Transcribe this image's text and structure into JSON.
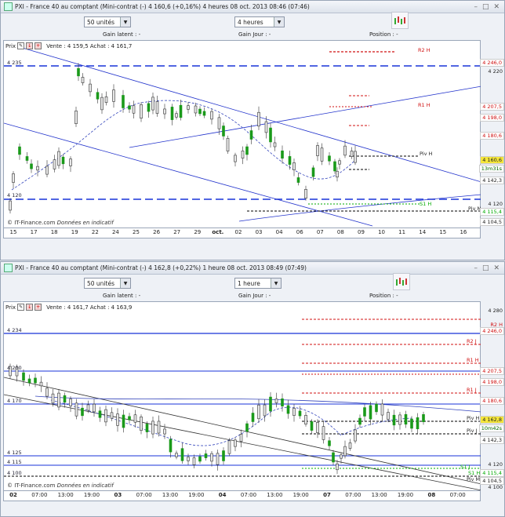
{
  "w1": {
    "title": "PXI - France 40 au comptant (Mini-contrat  (-)  4 160,6 (+0,16%)  4 heures  08 oct. 2013 08:46 (07:46)",
    "units": "50 unités",
    "period": "4 heures",
    "gain_latent": "Gain latent : -",
    "gain_jour": "Gain Jour : -",
    "position": "Position : -",
    "prix": "Prix",
    "quote": "Vente : 4 159,5 Achat : 4 161,7",
    "credit_a": "© IT-Finance.com",
    "credit_b": "Données en indicatif",
    "left_levels": [
      "4 235",
      "4 120"
    ],
    "axis_prices": [
      "4 246,0",
      "4 220",
      "4 207,5",
      "4 198,0",
      "4 180,6",
      "4 160,6",
      "13m31s",
      "4 142,3",
      "4 120",
      "4 115,4",
      "4 104,5"
    ],
    "pivots": [
      "R2 H",
      "R1 H",
      "Piv H",
      "S1 H",
      "Piv M"
    ],
    "xlabels": [
      "15",
      "17",
      "18",
      "19",
      "22",
      "24",
      "25",
      "26",
      "27",
      "29",
      "oct.",
      "02",
      "03",
      "04",
      "06",
      "07",
      "08",
      "09",
      "10",
      "11",
      "14",
      "15",
      "16"
    ]
  },
  "w2": {
    "title": "PXI - France 40 au comptant (Mini-contrat  (-)  4 162,8 (+0,22%)  1 heure  08 oct. 2013 08:49 (07:49)",
    "units": "50 unités",
    "period": "1 heure",
    "gain_latent": "Gain latent : -",
    "gain_jour": "Gain Jour : -",
    "position": "Position : -",
    "prix": "Prix",
    "quote": "Vente : 4 161,7 Achat : 4 163,9",
    "credit_a": "© IT-Finance.com",
    "credit_b": "Données en indicatif",
    "left_levels": [
      "4 234",
      "4 200",
      "4 170",
      "4 125",
      "4 115",
      "4 100"
    ],
    "axis_prices": [
      "4 280",
      "R2 H",
      "4 246,0",
      "4 207,5",
      "4 198,0",
      "4 180,6",
      "4 162,8",
      "10m42s",
      "4 142,3",
      "4 120",
      "4 115,4",
      "4 104,5",
      "4 100"
    ],
    "pivots": [
      "R2 J",
      "R1 H",
      "R1 J",
      "Piv H",
      "Piv J",
      "S1 J",
      "S1 H",
      "Piv M"
    ],
    "xlabels": [
      "02",
      "07:00",
      "13:00",
      "19:00",
      "03",
      "07:00",
      "13:00",
      "19:00",
      "04",
      "07:00",
      "13:00",
      "19:00",
      "07",
      "07:00",
      "13:00",
      "19:00",
      "08",
      "07:00"
    ]
  }
}
